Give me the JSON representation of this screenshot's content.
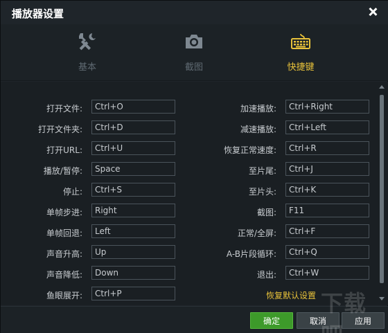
{
  "window": {
    "title": "播放器设置"
  },
  "tabs": [
    {
      "label": "基本",
      "icon": "tools-icon",
      "active": false
    },
    {
      "label": "截图",
      "icon": "camera-icon",
      "active": false
    },
    {
      "label": "快捷键",
      "icon": "keyboard-icon",
      "active": true
    }
  ],
  "shortcuts_left": [
    {
      "label": "打开文件:",
      "value": "Ctrl+O"
    },
    {
      "label": "打开文件夹:",
      "value": "Ctrl+D"
    },
    {
      "label": "打开URL:",
      "value": "Ctrl+U"
    },
    {
      "label": "播放/暂停:",
      "value": "Space"
    },
    {
      "label": "停止:",
      "value": "Ctrl+S"
    },
    {
      "label": "单帧步进:",
      "value": "Right"
    },
    {
      "label": "单帧回退:",
      "value": "Left"
    },
    {
      "label": "声音升高:",
      "value": "Up"
    },
    {
      "label": "声音降低:",
      "value": "Down"
    },
    {
      "label": "鱼眼展开:",
      "value": "Ctrl+P"
    }
  ],
  "shortcuts_right": [
    {
      "label": "加速播放:",
      "value": "Ctrl+Right"
    },
    {
      "label": "减速播放:",
      "value": "Ctrl+Left"
    },
    {
      "label": "恢复正常速度:",
      "value": "Ctrl+R"
    },
    {
      "label": "至片尾:",
      "value": "Ctrl+J"
    },
    {
      "label": "至片头:",
      "value": "Ctrl+K"
    },
    {
      "label": "截图:",
      "value": "F11"
    },
    {
      "label": "正常/全屏:",
      "value": "Ctrl+F"
    },
    {
      "label": "A-B片段循环:",
      "value": "Ctrl+Q"
    },
    {
      "label": "退出:",
      "value": "Ctrl+W"
    }
  ],
  "restore_defaults": "恢复默认设置",
  "buttons": {
    "ok": "确定",
    "cancel": "取消",
    "apply": "应用"
  },
  "watermark": "下载吧",
  "colors": {
    "accent": "#e8c23a",
    "ok_button": "#3d9a2a",
    "background": "#1f252a"
  }
}
